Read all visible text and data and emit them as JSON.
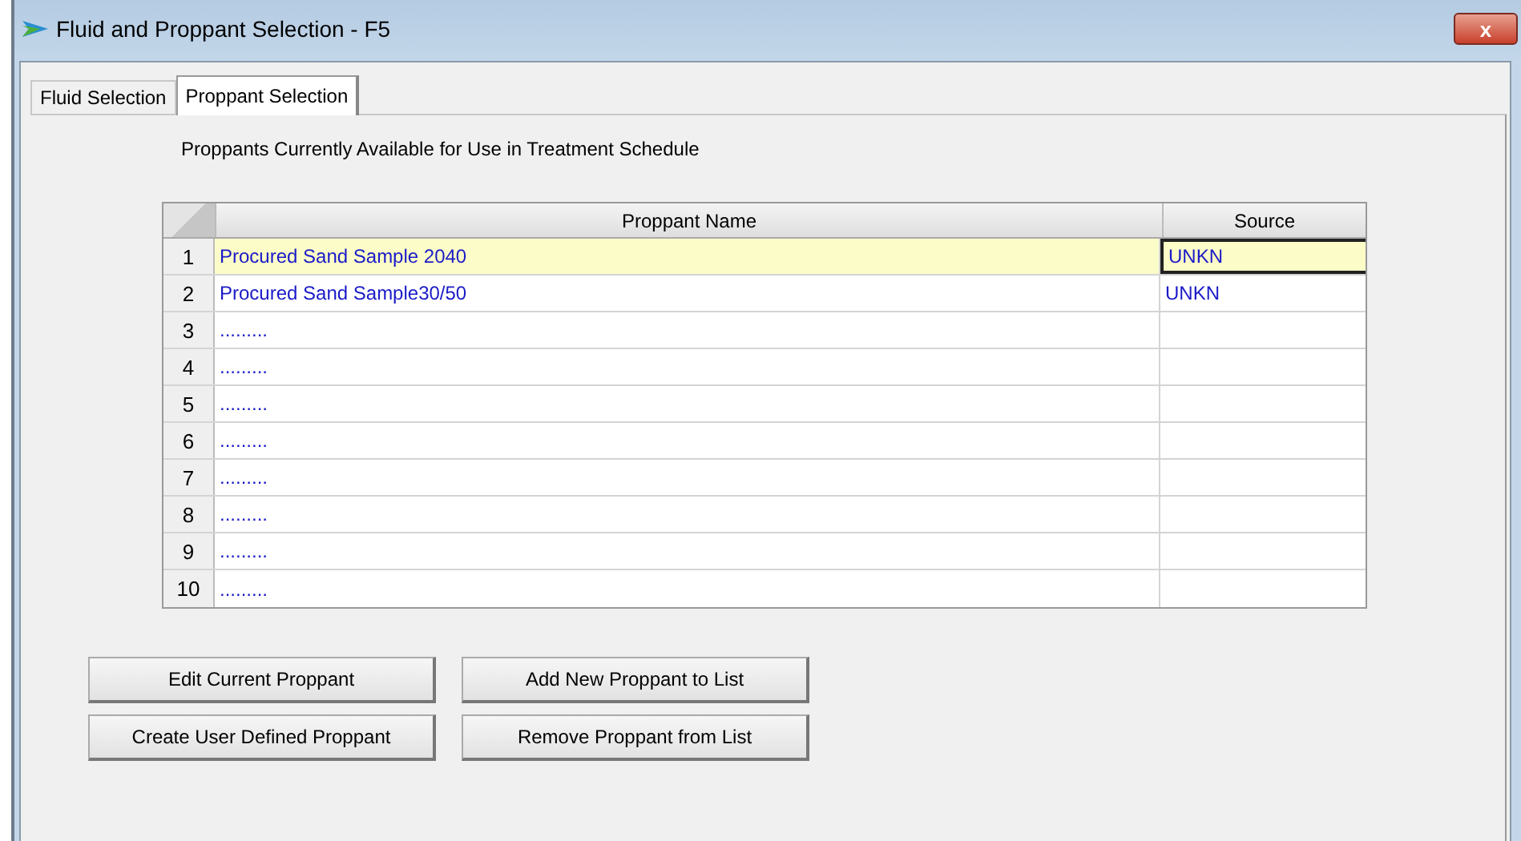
{
  "window": {
    "title": "Fluid and Proppant Selection - F5",
    "close": "x"
  },
  "tabs": [
    {
      "label": "Fluid Selection",
      "selected": false
    },
    {
      "label": "Proppant Selection",
      "selected": true
    }
  ],
  "caption": "Proppants Currently Available for Use in Treatment Schedule",
  "table": {
    "columns": [
      "Proppant Name",
      "Source"
    ],
    "rows": [
      {
        "number": "1",
        "name": "Procured Sand Sample 2040",
        "source": "UNKN",
        "selected": true
      },
      {
        "number": "2",
        "name": "Procured Sand Sample30/50",
        "source": "UNKN",
        "selected": false
      },
      {
        "number": "3",
        "name": ".........",
        "selected": false
      },
      {
        "number": "4",
        "name": ".........",
        "selected": false
      },
      {
        "number": "5",
        "name": ".........",
        "selected": false
      },
      {
        "number": "6",
        "name": ".........",
        "selected": false
      },
      {
        "number": "7",
        "name": ".........",
        "selected": false
      },
      {
        "number": "8",
        "name": ".........",
        "selected": false
      },
      {
        "number": "9",
        "name": ".........",
        "selected": false
      },
      {
        "number": "10",
        "name": ".........",
        "selected": false
      }
    ]
  },
  "buttons": [
    [
      "Edit Current Proppant",
      "Create User Defined Proppant"
    ],
    [
      "Add New Proppant to List",
      "Remove Proppant from List"
    ]
  ]
}
